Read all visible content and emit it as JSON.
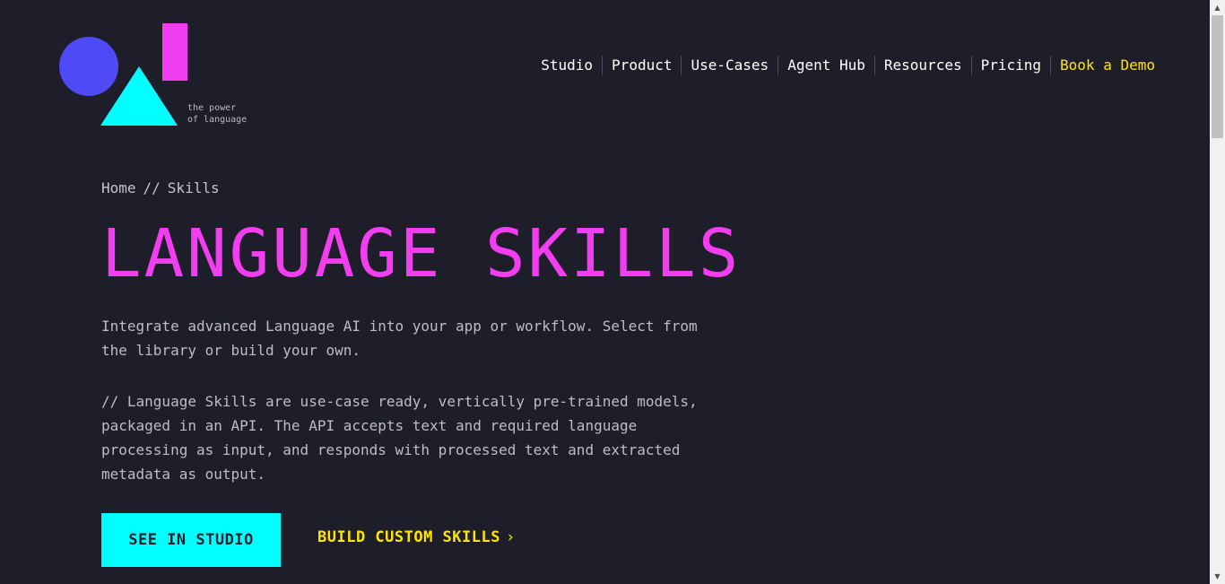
{
  "logo": {
    "tagline_line1": "the power",
    "tagline_line2": "of language",
    "colors": {
      "circle": "#4e4af5",
      "rect": "#f23ef0",
      "triangle": "#00ffff"
    }
  },
  "nav": {
    "items": [
      {
        "label": "Studio"
      },
      {
        "label": "Product"
      },
      {
        "label": "Use-Cases"
      },
      {
        "label": "Agent Hub"
      },
      {
        "label": "Resources"
      },
      {
        "label": "Pricing"
      },
      {
        "label": "Book a Demo"
      }
    ]
  },
  "breadcrumb": {
    "home": "Home",
    "separator": "//",
    "current": "Skills"
  },
  "hero": {
    "title": "LANGUAGE SKILLS",
    "intro": "Integrate advanced Language AI into your app or workflow. Select from the library or build your own.",
    "description": "// Language Skills are use-case ready, vertically pre-trained models, packaged in an API. The API accepts text and required language processing as input, and responds with processed text and extracted metadata as output.",
    "primary_button": "SEE IN STUDIO",
    "secondary_link": "BUILD CUSTOM SKILLS",
    "secondary_chevron": "›"
  },
  "scrollbar": {
    "up_arrow": "▲",
    "down_arrow": "▼"
  },
  "colors": {
    "background": "#1e1d2a",
    "accent_magenta": "#f23ef0",
    "accent_cyan": "#00ffff",
    "accent_yellow": "#ffe600"
  }
}
